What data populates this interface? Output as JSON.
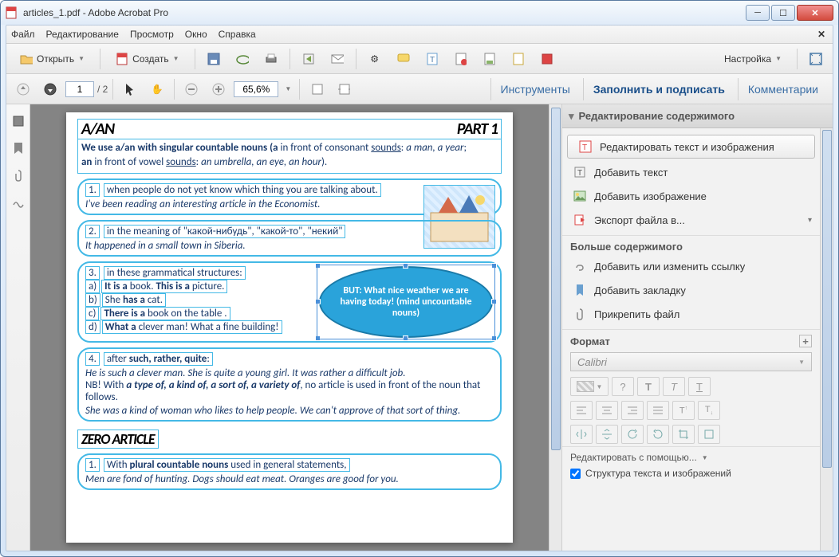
{
  "window": {
    "title": "articles_1.pdf - Adobe Acrobat Pro"
  },
  "menu": {
    "file": "Файл",
    "edit": "Редактирование",
    "view": "Просмотр",
    "window": "Окно",
    "help": "Справка"
  },
  "toolbar1": {
    "open": "Открыть",
    "create": "Создать",
    "settings": "Настройка"
  },
  "toolbar2": {
    "page_current": "1",
    "page_total": "/ 2",
    "zoom": "65,6%",
    "tools": "Инструменты",
    "fill_sign": "Заполнить и подписать",
    "comments": "Комментарии"
  },
  "doc": {
    "heading_a_an": "A/AN",
    "heading_part": "PART 1",
    "intro_1a": "We use a/an with singular countable nouns (a ",
    "intro_1b": "in front of consonant ",
    "intro_1c": "sounds",
    "intro_1d": ": ",
    "intro_1e": "a man, a year",
    "intro_1f": ";",
    "intro_2a": "an ",
    "intro_2b": "in front of vowel ",
    "intro_2c": "sounds",
    "intro_2d": ": ",
    "intro_2e": "an umbrella, an eye, an hour",
    "intro_2f": ").",
    "b1_num": "1.",
    "b1_text": "when people do not yet know which thing you are talking about.",
    "b1_italic": "I've been reading an interesting article in the Economist.",
    "b2_num": "2.",
    "b2_text": "in the meaning of \"какой-нибудь\", \"какой-то\", \"некий\"",
    "b2_italic": "It happened in a small town in Siberia.",
    "b3_num": "3.",
    "b3_text": "in these grammatical structures:",
    "b3_a": "a) ",
    "b3_a_t": "It is a ",
    "b3_a_t2": "book. ",
    "b3_a_t3": "This is a ",
    "b3_a_t4": "picture.",
    "b3_b": "b) ",
    "b3_b_t": "She ",
    "b3_b_t2": "has a ",
    "b3_b_t3": "cat.",
    "b3_c": "c) ",
    "b3_c_t": "There is a ",
    "b3_c_t2": "book on the table .",
    "b3_d": "d) ",
    "b3_d_t": "What a ",
    "b3_d_t2": "clever man! What a fine building!",
    "ellipse": "BUT: What nice weather we are having today! (mind uncountable nouns)",
    "b4_num": "4.",
    "b4_text": "after ",
    "b4_bold": "such, rather, quite",
    "b4_colon": ":",
    "b4_l1": "He is such a clever man.   She is quite a young girl.   It was rather a difficult job.",
    "b4_l2a": "NB! With ",
    "b4_l2b": "a type of, a kind of, a sort of, a variety of",
    "b4_l2c": ", no article is used in front of the noun that follows.",
    "b4_l3": "She was a kind of woman who likes to help people.    We can't approve of that sort of thing.",
    "zero_title": "ZERO ARTICLE",
    "z1_num": "1.",
    "z1_a": "With ",
    "z1_b": "plural countable nouns ",
    "z1_c": "used in general statements,",
    "z1_l": "Men are fond of hunting.       Dogs should eat meat.        Oranges are good for you."
  },
  "rightpanel": {
    "header": "Редактирование содержимого",
    "edit_text_img": "Редактировать текст и изображения",
    "add_text": "Добавить текст",
    "add_image": "Добавить изображение",
    "export": "Экспорт файла в...",
    "more_content": "Больше содержимого",
    "edit_link": "Добавить или изменить ссылку",
    "add_bookmark": "Добавить закладку",
    "attach_file": "Прикрепить файл",
    "format": "Формат",
    "font": "Calibri",
    "q": "?",
    "b": "T",
    "i": "T",
    "u": "T",
    "edit_with": "Редактировать с помощью...",
    "checkbox": "Структура текста и изображений"
  }
}
